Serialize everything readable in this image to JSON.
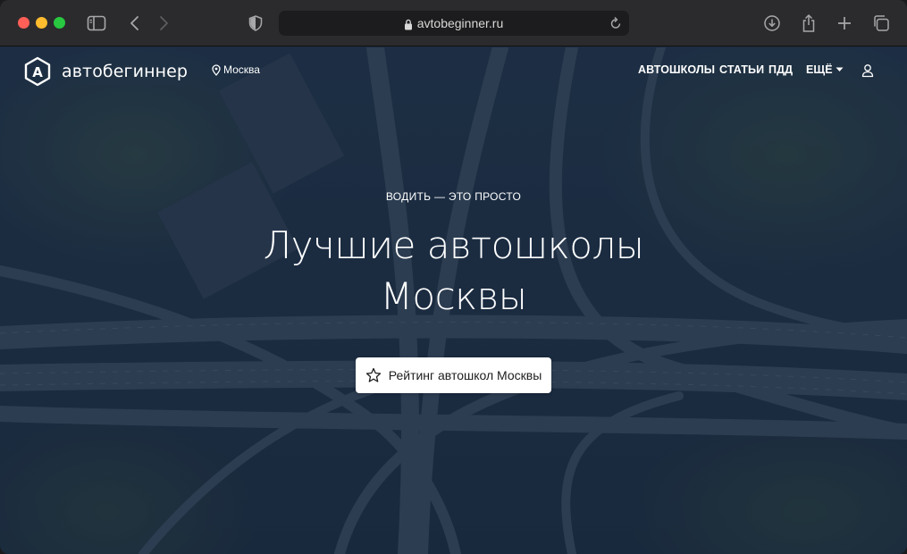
{
  "browser": {
    "url": "avtobeginner.ru",
    "icons": [
      "sidebar-icon",
      "back-icon",
      "forward-icon",
      "shield-icon",
      "lock-icon",
      "reload-icon",
      "download-icon",
      "share-icon",
      "new-tab-icon",
      "tabs-overview-icon"
    ]
  },
  "site": {
    "logo_letter": "A",
    "logo_text": "автобегиннер",
    "city": "Москва",
    "nav": [
      {
        "label": "АВТОШКОЛЫ"
      },
      {
        "label": "СТАТЬИ"
      },
      {
        "label": "ПДД"
      },
      {
        "label": "ЕЩЁ"
      }
    ]
  },
  "hero": {
    "eyebrow": "ВОДИТЬ — ЭТО ПРОСТО",
    "title_line1": "Лучшие автошколы",
    "title_line2": "Москвы",
    "cta_label": "Рейтинг автошкол Москвы"
  },
  "colors": {
    "chrome": "#2b2b2d",
    "url_field": "#1c1c1e",
    "hero_overlay": "#1f2f44",
    "text": "#ffffff"
  }
}
